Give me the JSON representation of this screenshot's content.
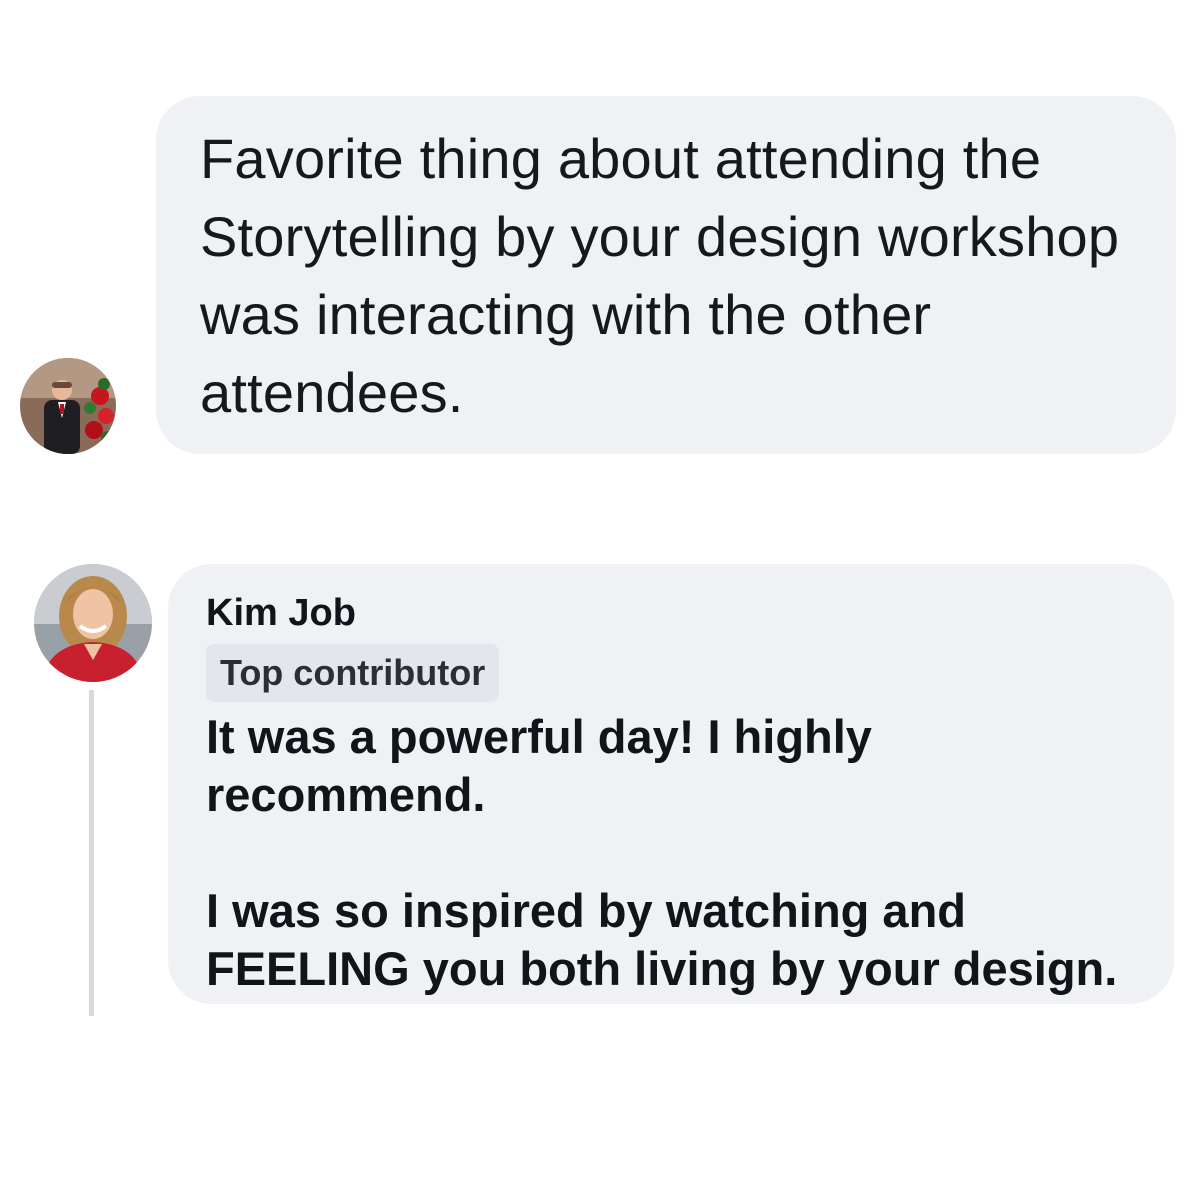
{
  "post": {
    "text": "Favorite thing about attending the Storytelling by your design workshop was interacting with the other attendees."
  },
  "comment": {
    "author": "Kim Job",
    "badge": "Top contributor",
    "paragraph_1": "It was a powerful day!  I highly recommend.",
    "paragraph_2": "I was so inspired by watching and FEELING you both living by your design."
  },
  "colors": {
    "bubble_background": "#eff1f5",
    "badge_background": "#e3e6eb",
    "thread_line": "#d8dadf"
  },
  "icons": {
    "post_author": "avatar-photo-man",
    "comment_author": "avatar-photo-woman"
  }
}
